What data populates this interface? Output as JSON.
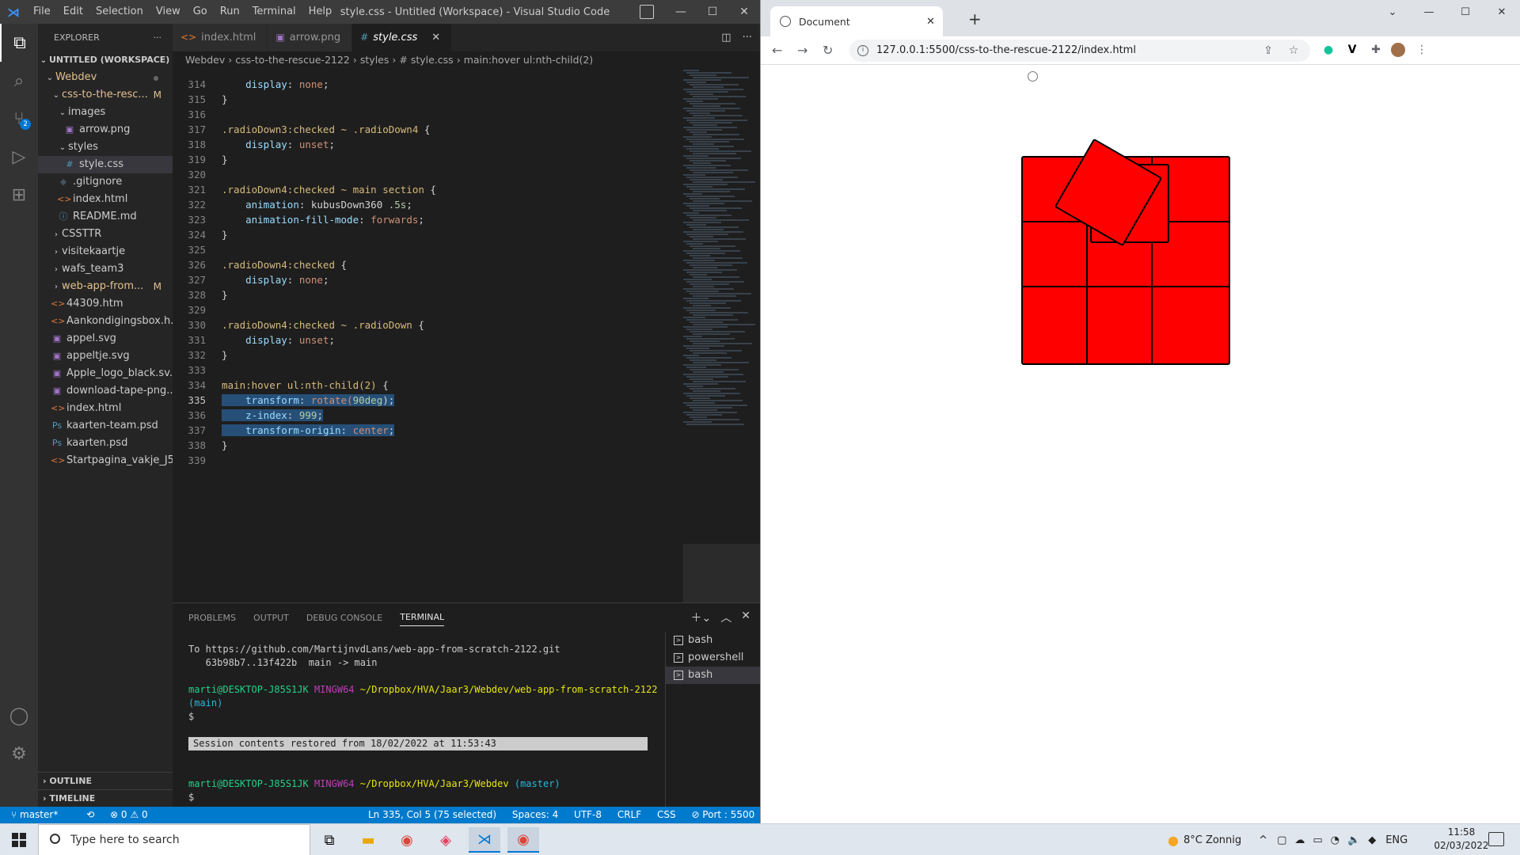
{
  "vscode": {
    "menu": [
      "File",
      "Edit",
      "Selection",
      "View",
      "Go",
      "Run",
      "Terminal",
      "Help"
    ],
    "window_title": "style.css - Untitled (Workspace) - Visual Studio Code",
    "sidebar": {
      "header": "EXPLORER",
      "workspace": "UNTITLED (WORKSPACE)",
      "items": [
        {
          "label": "Webdev",
          "indent": 1,
          "chev": "⌄",
          "badge": ""
        },
        {
          "label": "css-to-the-resc...",
          "indent": 2,
          "chev": "⌄",
          "badge": "M"
        },
        {
          "label": "images",
          "indent": 3,
          "chev": "⌄",
          "badge": ""
        },
        {
          "label": "arrow.png",
          "indent": 4,
          "icon": "img",
          "badge": ""
        },
        {
          "label": "styles",
          "indent": 3,
          "chev": "⌄",
          "badge": ""
        },
        {
          "label": "style.css",
          "indent": 4,
          "icon": "#",
          "badge": ""
        },
        {
          "label": ".gitignore",
          "indent": 3,
          "icon": "◆",
          "badge": ""
        },
        {
          "label": "index.html",
          "indent": 3,
          "icon": "<>",
          "badge": ""
        },
        {
          "label": "README.md",
          "indent": 3,
          "icon": "ⓘ",
          "badge": ""
        },
        {
          "label": "CSSTTR",
          "indent": 2,
          "chev": "›",
          "badge": ""
        },
        {
          "label": "visitekaartje",
          "indent": 2,
          "chev": "›",
          "badge": ""
        },
        {
          "label": "wafs_team3",
          "indent": 2,
          "chev": "›",
          "badge": ""
        },
        {
          "label": "web-app-from...",
          "indent": 2,
          "chev": "›",
          "badge": "M"
        },
        {
          "label": "44309.htm",
          "indent": 2,
          "icon": "<>",
          "badge": ""
        },
        {
          "label": "Aankondigingsbox.h...",
          "indent": 2,
          "icon": "<>",
          "badge": ""
        },
        {
          "label": "appel.svg",
          "indent": 2,
          "icon": "img",
          "badge": ""
        },
        {
          "label": "appeltje.svg",
          "indent": 2,
          "icon": "img",
          "badge": ""
        },
        {
          "label": "Apple_logo_black.sv...",
          "indent": 2,
          "icon": "img",
          "badge": ""
        },
        {
          "label": "download-tape-png...",
          "indent": 2,
          "icon": "img",
          "badge": ""
        },
        {
          "label": "index.html",
          "indent": 2,
          "icon": "<>",
          "badge": ""
        },
        {
          "label": "kaarten-team.psd",
          "indent": 2,
          "icon": "ps",
          "badge": ""
        },
        {
          "label": "kaarten.psd",
          "indent": 2,
          "icon": "ps",
          "badge": ""
        },
        {
          "label": "Startpagina_vakje_J5...",
          "indent": 2,
          "icon": "<>",
          "badge": ""
        }
      ],
      "outline": "OUTLINE",
      "timeline": "TIMELINE"
    },
    "tabs": [
      {
        "label": "index.html",
        "icon": "<>"
      },
      {
        "label": "arrow.png",
        "icon": "img"
      },
      {
        "label": "style.css",
        "icon": "#"
      }
    ],
    "breadcrumb": [
      "Webdev",
      "css-to-the-rescue-2122",
      "styles",
      "# style.css",
      "main:hover ul:nth-child(2)"
    ],
    "source_control_badge": "2",
    "code_lines": [
      {
        "n": "314",
        "segs": [
          [
            "    ",
            ""
          ],
          [
            "display",
            "k-prop"
          ],
          [
            ": ",
            "k-op"
          ],
          [
            "none",
            "k-val"
          ],
          [
            ";",
            "k-op"
          ]
        ]
      },
      {
        "n": "315",
        "segs": [
          [
            "}",
            "k-op"
          ]
        ]
      },
      {
        "n": "316",
        "segs": []
      },
      {
        "n": "317",
        "segs": [
          [
            ".radioDown3:checked ~ .radioDown4 ",
            "k-sel"
          ],
          [
            "{",
            "k-op"
          ]
        ]
      },
      {
        "n": "318",
        "segs": [
          [
            "    ",
            ""
          ],
          [
            "display",
            "k-prop"
          ],
          [
            ": ",
            "k-op"
          ],
          [
            "unset",
            "k-val"
          ],
          [
            ";",
            "k-op"
          ]
        ]
      },
      {
        "n": "319",
        "segs": [
          [
            "}",
            "k-op"
          ]
        ]
      },
      {
        "n": "320",
        "segs": []
      },
      {
        "n": "321",
        "segs": [
          [
            ".radioDown4:checked ~ main section ",
            "k-sel"
          ],
          [
            "{",
            "k-op"
          ]
        ]
      },
      {
        "n": "322",
        "segs": [
          [
            "    ",
            ""
          ],
          [
            "animation",
            "k-prop"
          ],
          [
            ": ",
            "k-op"
          ],
          [
            "kubusDown360 ",
            "k-op"
          ],
          [
            ".5s",
            "k-num"
          ],
          [
            ";",
            "k-op"
          ]
        ]
      },
      {
        "n": "323",
        "segs": [
          [
            "    ",
            ""
          ],
          [
            "animation-fill-mode",
            "k-prop"
          ],
          [
            ": ",
            "k-op"
          ],
          [
            "forwards",
            "k-val"
          ],
          [
            ";",
            "k-op"
          ]
        ]
      },
      {
        "n": "324",
        "segs": [
          [
            "}",
            "k-op"
          ]
        ]
      },
      {
        "n": "325",
        "segs": []
      },
      {
        "n": "326",
        "segs": [
          [
            ".radioDown4:checked ",
            "k-sel"
          ],
          [
            "{",
            "k-op"
          ]
        ]
      },
      {
        "n": "327",
        "segs": [
          [
            "    ",
            ""
          ],
          [
            "display",
            "k-prop"
          ],
          [
            ": ",
            "k-op"
          ],
          [
            "none",
            "k-val"
          ],
          [
            ";",
            "k-op"
          ]
        ]
      },
      {
        "n": "328",
        "segs": [
          [
            "}",
            "k-op"
          ]
        ]
      },
      {
        "n": "329",
        "segs": []
      },
      {
        "n": "330",
        "segs": [
          [
            ".radioDown4:checked ~ .radioDown ",
            "k-sel"
          ],
          [
            "{",
            "k-op"
          ]
        ]
      },
      {
        "n": "331",
        "segs": [
          [
            "    ",
            ""
          ],
          [
            "display",
            "k-prop"
          ],
          [
            ": ",
            "k-op"
          ],
          [
            "unset",
            "k-val"
          ],
          [
            ";",
            "k-op"
          ]
        ]
      },
      {
        "n": "332",
        "segs": [
          [
            "}",
            "k-op"
          ]
        ]
      },
      {
        "n": "333",
        "segs": []
      },
      {
        "n": "334",
        "segs": [
          [
            "main:hover ul:nth-child(2) ",
            "k-sel"
          ],
          [
            "{",
            "k-op"
          ]
        ]
      },
      {
        "n": "335",
        "cur": true,
        "segs": [
          [
            "    ",
            "sel"
          ],
          [
            "transform",
            "k-prop sel"
          ],
          [
            ": ",
            "k-op sel"
          ],
          [
            "rotate(",
            "k-val sel"
          ],
          [
            "90deg",
            "k-num sel"
          ],
          [
            ");",
            "k-op sel"
          ]
        ]
      },
      {
        "n": "336",
        "segs": [
          [
            "    ",
            "sel"
          ],
          [
            "z-index",
            "k-prop sel"
          ],
          [
            ": ",
            "k-op sel"
          ],
          [
            "999",
            "k-num sel"
          ],
          [
            ";",
            "k-op sel"
          ]
        ]
      },
      {
        "n": "337",
        "segs": [
          [
            "    ",
            "sel"
          ],
          [
            "transform-origin",
            "k-prop sel"
          ],
          [
            ": ",
            "k-op sel"
          ],
          [
            "center",
            "k-val sel"
          ],
          [
            ";",
            "k-op sel"
          ]
        ]
      },
      {
        "n": "338",
        "segs": [
          [
            "}",
            "k-op"
          ]
        ]
      },
      {
        "n": "339",
        "segs": []
      }
    ],
    "panel_tabs": [
      "PROBLEMS",
      "OUTPUT",
      "DEBUG CONSOLE",
      "TERMINAL"
    ],
    "terminal": {
      "line1": "To https://github.com/MartijnvdLans/web-app-from-scratch-2122.git",
      "line2": "   63b98b7..13f422b  main -> main",
      "user": "marti@DESKTOP-J85S1JK",
      "mingw": "MINGW64",
      "path1": "~/Dropbox/HVA/Jaar3/Webdev/web-app-from-scratch-2122",
      "branch1": "(main)",
      "prompt": "$",
      "restored": "Session contents restored from 18/02/2022 at 11:53:43",
      "path2": "~/Dropbox/HVA/Jaar3/Webdev",
      "branch2": "(master)"
    },
    "terminal_list": [
      "bash",
      "powershell",
      "bash"
    ],
    "status": {
      "branch": "master*",
      "problems": "⊗ 0 ⚠ 0",
      "position": "Ln 335, Col 5 (75 selected)",
      "spaces": "Spaces: 4",
      "encoding": "UTF-8",
      "eol": "CRLF",
      "lang": "CSS",
      "port": "⊘ Port : 5500"
    }
  },
  "browser": {
    "tab_title": "Document",
    "url": "127.0.0.1:5500/css-to-the-rescue-2122/index.html",
    "colors": {
      "cube": "#ff0000",
      "accent": "#ffff00"
    }
  },
  "taskbar": {
    "search_placeholder": "Type here to search",
    "weather": "8°C  Zonnig",
    "lang": "ENG",
    "time": "11:58",
    "date": "02/03/2022"
  }
}
